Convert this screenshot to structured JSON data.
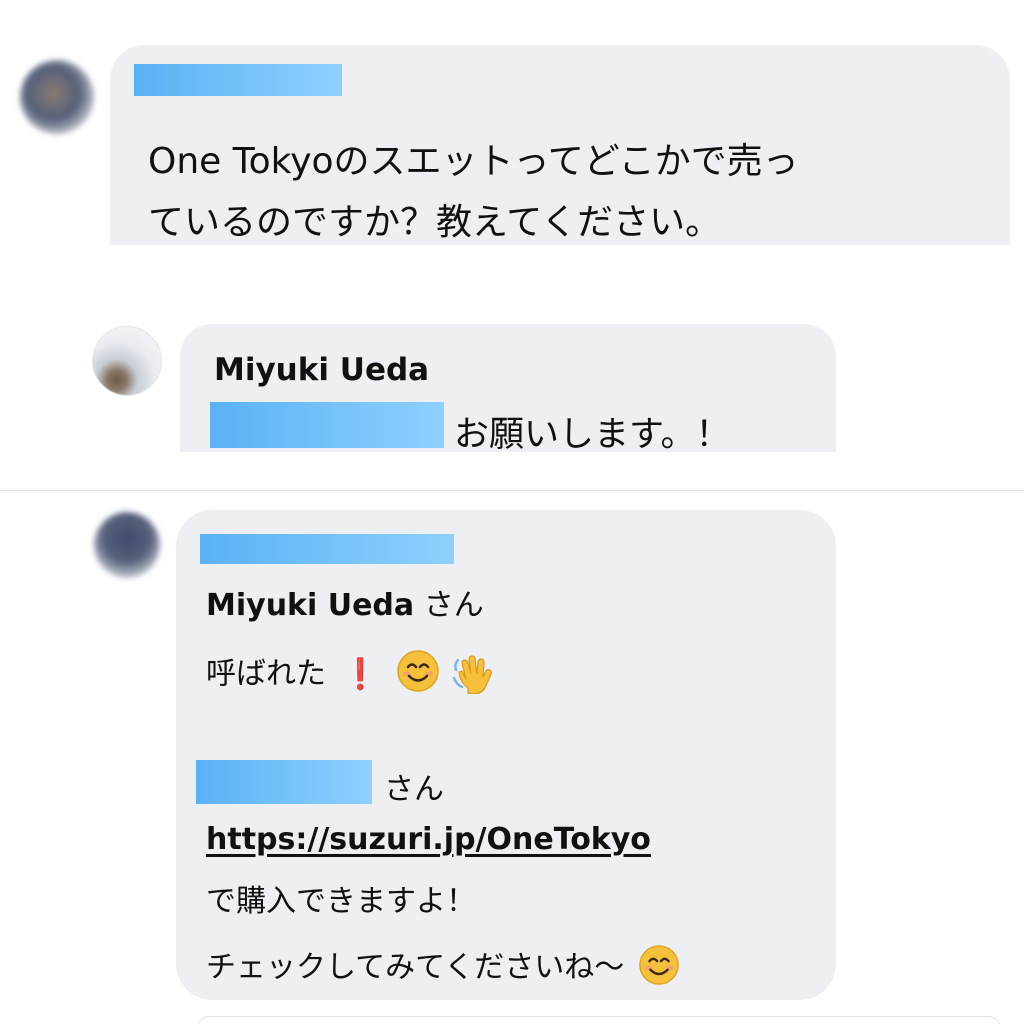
{
  "comment1": {
    "text_line1": "One Tokyoのスエットってどこかで売っ",
    "text_line2": "ているのですか？教えてください。"
  },
  "comment2": {
    "author": "Miyuki Ueda",
    "text": "お願いします。！"
  },
  "comment3": {
    "mention_name": "Miyuki Ueda",
    "mention_suffix": " さん",
    "line_called": "呼ばれた",
    "exclamation": "❗",
    "second_mention_suffix": "さん",
    "link": "https://suzuri.jp/OneTokyo",
    "line_buy": "で購入できますよ！",
    "line_check": "チェックしてみてくださいね〜"
  },
  "icons": [
    "exclamation-icon",
    "smiling-face-icon",
    "waving-hand-icon"
  ],
  "colors": {
    "bubble": "#eeeff2",
    "redaction": "#59b2f4",
    "exclamation": "#e0201b",
    "emoji": "#f5c03a"
  }
}
